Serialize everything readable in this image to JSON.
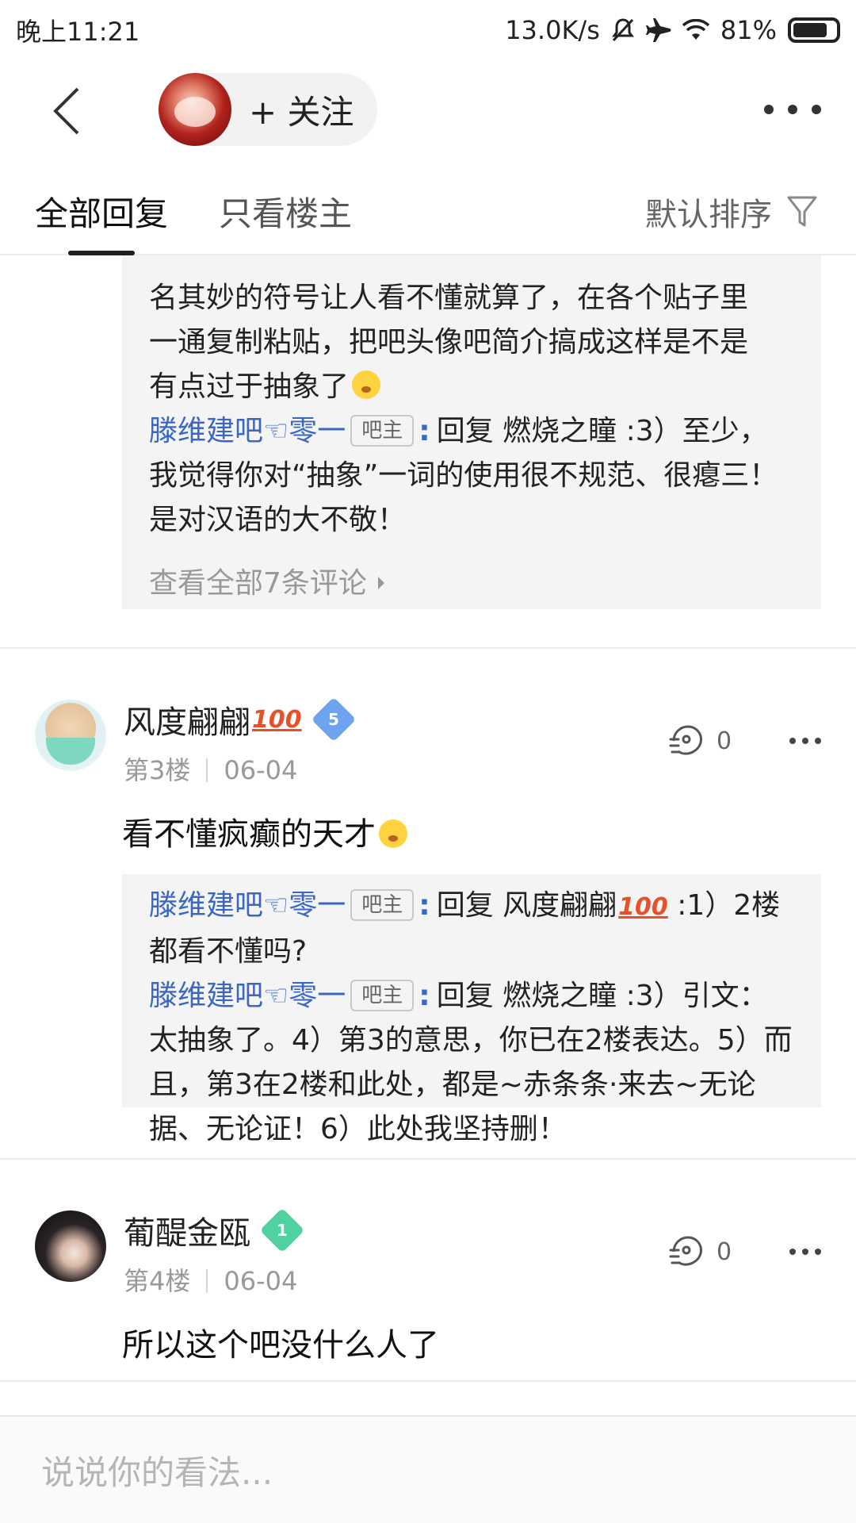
{
  "status_bar": {
    "time": "晚上11:21",
    "network_speed": "13.0K/s",
    "battery": "81%",
    "battery_level": 0.81
  },
  "nav": {
    "follow_label": "+ 关注"
  },
  "tabs": {
    "all_replies": "全部回复",
    "author_only": "只看楼主",
    "sort_label": "默认排序"
  },
  "floor2": {
    "reply_lines": [
      "名其妙的符号让人看不懂就算了，在各个贴子里",
      "一通复制粘贴，把吧头像吧简介搞成这样是不是",
      "有点过于抽象了"
    ],
    "reply2": {
      "user": "滕维建吧☜零一",
      "badge": "吧主",
      "text_line1": "回复 燃烧之瞳 :3）至少，",
      "lines": [
        "我觉得你对“抽象”一词的使用很不规范、很瘪三！",
        "是对汉语的大不敬！"
      ]
    },
    "view_all": "查看全部7条评论"
  },
  "floor3": {
    "username": "风度翩翩",
    "level": "5",
    "floor": "第3楼",
    "date": "06-04",
    "likes": "0",
    "content": "看不懂疯癫的天才",
    "replies": [
      {
        "user": "滕维建吧☜零一",
        "badge": "吧主",
        "text_line1_a": "回复 风度翩翩",
        "text_line1_b": " :1）2楼",
        "lines": [
          "都看不懂吗?"
        ]
      },
      {
        "user": "滕维建吧☜零一",
        "badge": "吧主",
        "text_line1": "回复 燃烧之瞳 :3）引文：",
        "lines": [
          "太抽象了。4）第3的意思，你已在2楼表达。5）而",
          "且，第3在2楼和此处，都是~赤条条·来去~无论",
          "据、无论证！6）此处我坚持删！"
        ]
      }
    ]
  },
  "floor4": {
    "username": "葡醍金瓯",
    "level": "1",
    "floor": "第4楼",
    "date": "06-04",
    "likes": "0",
    "content": "所以这个吧没什么人了"
  },
  "comment_box": {
    "placeholder": "说说你的看法..."
  },
  "colors": {
    "username_blue": "#3a67c2",
    "reply_bg": "#f4f4f4",
    "level_blue": "#6ea3f0",
    "level_green": "#4fd2a0"
  }
}
